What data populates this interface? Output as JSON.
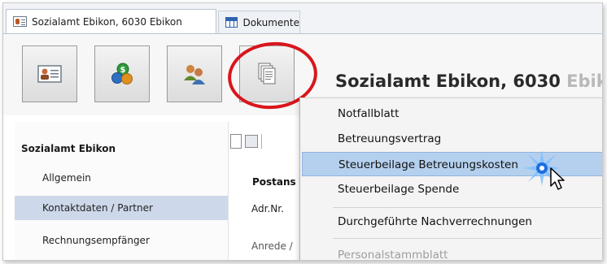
{
  "tabs": [
    {
      "label": "Sozialamt Ebikon, 6030 Ebikon",
      "icon": "contact-card-icon",
      "active": true
    },
    {
      "label": "Dokumente",
      "icon": "grid-table-icon",
      "active": false
    }
  ],
  "toolbar": {
    "buttons": [
      {
        "icon": "contact-card-icon"
      },
      {
        "icon": "coins-money-icon"
      },
      {
        "icon": "people-partners-icon"
      },
      {
        "icon": "documents-stack-icon"
      }
    ],
    "highlight_color": "#d9161b"
  },
  "header": {
    "title_main": "Sozialamt Ebikon, 6030 ",
    "title_fade": "Ebiko"
  },
  "sidebar": {
    "title": "Sozialamt Ebikon",
    "items": [
      {
        "label": "Allgemein",
        "selected": false
      },
      {
        "label": "Kontaktdaten / Partner",
        "selected": true
      },
      {
        "label": "Rechnungsempfänger",
        "selected": false
      }
    ],
    "selected_color": "#cdd9ea"
  },
  "form": {
    "group_title": "Postans",
    "labels": [
      "Adr.Nr.",
      "Anrede /"
    ]
  },
  "menu": {
    "items": [
      {
        "label": "Notfallblatt",
        "state": "normal"
      },
      {
        "label": "Betreuungsvertrag",
        "state": "normal"
      },
      {
        "label": "Steuerbeilage Betreuungskosten",
        "state": "highlight"
      },
      {
        "label": "Steuerbeilage Spende",
        "state": "normal"
      },
      {
        "label": "Durchgeführte Nachverrechnungen",
        "state": "normal"
      },
      {
        "label": "Personalstammblatt",
        "state": "disabled"
      }
    ],
    "highlight_color": "#b5d0ee"
  }
}
